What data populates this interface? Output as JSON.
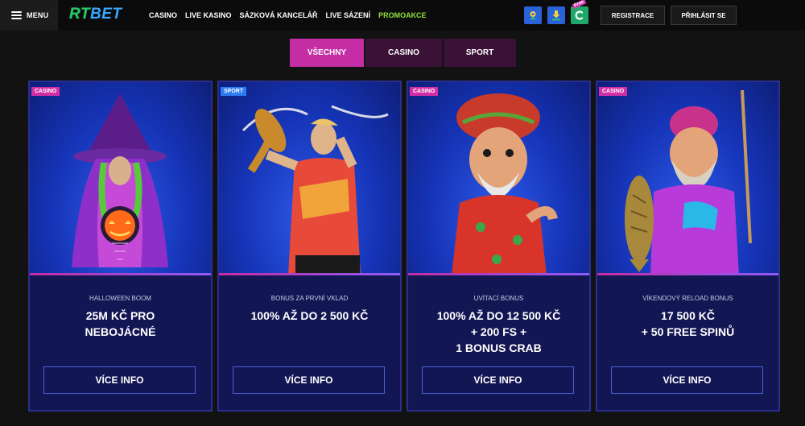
{
  "header": {
    "menu_label": "MENU",
    "logo_rt": "RT",
    "logo_bet": "BET",
    "nav": [
      "CASINO",
      "LIVE KASINO",
      "SÁZKOVÁ KANCELÁŘ",
      "LIVE SÁZENÍ",
      "PROMOAKCE"
    ],
    "free_tag": "Free",
    "register_label": "REGISTRACE",
    "login_label": "PŘIHLÁSIT SE"
  },
  "tabs": [
    "VŠECHNY",
    "CASINO",
    "SPORT"
  ],
  "active_tab": "VŠECHNY",
  "cards": [
    {
      "badge": "CASINO",
      "subtitle": "HALLOWEEN BOOM",
      "lines": [
        "25M KČ PRO",
        "NEBOJÁCNÉ"
      ],
      "button": "VÍCE INFO"
    },
    {
      "badge": "SPORT",
      "subtitle": "BONUS ZA PRVNÍ VKLAD",
      "lines": [
        "100% AŽ DO 2 500 KČ"
      ],
      "button": "VÍCE INFO"
    },
    {
      "badge": "CASINO",
      "subtitle": "UVÍTACÍ BONUS",
      "lines": [
        "100% AŽ DO 12 500 KČ",
        "+ 200 FS +",
        "1 BONUS CRAB"
      ],
      "button": "VÍCE INFO"
    },
    {
      "badge": "CASINO",
      "subtitle": "VÍKENDOVÝ RELOAD BONUS",
      "lines": [
        "17 500 KČ",
        "+ 50 FREE SPINŮ"
      ],
      "button": "VÍCE INFO"
    }
  ],
  "colors": {
    "accent_pink": "#c42da3",
    "promo_green": "#8fe03a",
    "card_blue": "#1c1f6b",
    "sport_badge": "#2f7bf0"
  },
  "icons": [
    "menu-icon",
    "location-icon",
    "download-icon",
    "free-bonus-icon"
  ]
}
